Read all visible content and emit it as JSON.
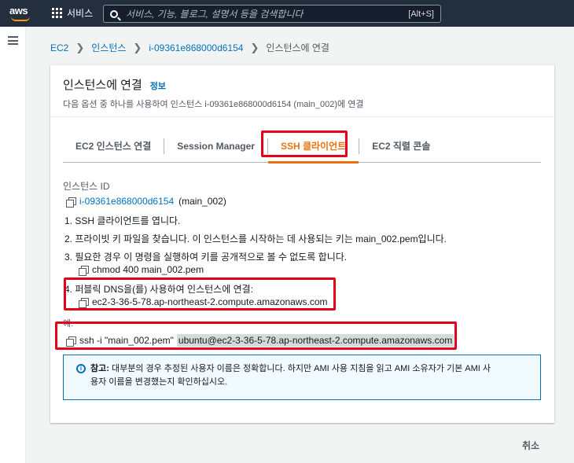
{
  "topbar": {
    "logo": "aws",
    "services_label": "서비스",
    "search_placeholder": "서비스, 기능, 블로그, 설명서 등을 검색합니다",
    "search_shortcut": "[Alt+S]"
  },
  "breadcrumb": {
    "items": [
      "EC2",
      "인스턴스",
      "i-09361e868000d6154",
      "인스턴스에 연결"
    ]
  },
  "panel": {
    "title": "인스턴스에 연결",
    "info_link": "정보",
    "subtitle": "다음 옵션 중 하나를 사용하여 인스턴스 i-09361e868000d6154 (main_002)에 연결"
  },
  "tabs": [
    {
      "label": "EC2 인스턴스 연결"
    },
    {
      "label": "Session Manager"
    },
    {
      "label": "SSH 클라이언트"
    },
    {
      "label": "EC2 직렬 콘솔"
    }
  ],
  "ssh": {
    "instance_id_label": "인스턴스 ID",
    "instance_id": "i-09361e868000d6154",
    "instance_name": "(main_002)",
    "step1": "1. SSH 클라이언트를 엽니다.",
    "step2": "2. 프라이빗 키 파일을 찾습니다. 이 인스턴스를 시작하는 데 사용되는 키는 main_002.pem입니다.",
    "step3": "3. 필요한 경우 이 명령을 실행하여 키를 공개적으로 볼 수 없도록 합니다.",
    "chmod_cmd": "chmod 400 main_002.pem",
    "step4": "4. 퍼블릭 DNS을(를) 사용하여 인스턴스에 연결:",
    "public_dns": "ec2-3-36-5-78.ap-northeast-2.compute.amazonaws.com",
    "example_label": "예:",
    "ssh_cmd_prefix": "ssh -i \"main_002.pem\"",
    "ssh_cmd_target": "ubuntu@ec2-3-36-5-78.ap-northeast-2.compute.amazonaws.com"
  },
  "note": {
    "label": "참고:",
    "text": "대부분의 경우 추정된 사용자 이름은 정확합니다. 하지만 AMI 사용 지침을 읽고 AMI 소유자가 기본 AMI 사",
    "text2": "용자 이름을 변경했는지 확인하십시오."
  },
  "footer": {
    "cancel_label": "취소"
  },
  "colors": {
    "topbar": "#232f3e",
    "accent": "#ec7211",
    "link": "#0073bb",
    "highlight_box": "#e4001a"
  }
}
